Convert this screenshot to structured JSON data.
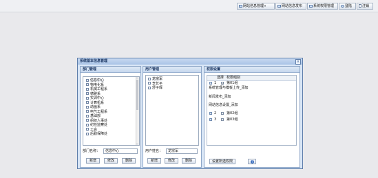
{
  "toolbar": {
    "dropdown_label": "网站信息管理",
    "items": [
      {
        "label": "网站信息发布"
      },
      {
        "label": "系统权限管理"
      },
      {
        "label": "登陆"
      },
      {
        "label": "注销"
      }
    ]
  },
  "window": {
    "title": "系统基本信息管理",
    "close_glyph": "×"
  },
  "dept_panel": {
    "header": "部门管理",
    "items": [
      "信息中心",
      "物电化系",
      "机械工程系",
      "德雅系",
      "实训中心",
      "计算机系",
      "动画系",
      "电气工程系",
      "基础部",
      "组织人事处",
      "纪检监察处",
      "工会",
      "后勤保障处"
    ],
    "name_label": "部门名称：",
    "name_value": "信息中心",
    "buttons": {
      "add": "新增",
      "edit": "修改",
      "delete": "删除"
    }
  },
  "user_panel": {
    "header": "用户管理",
    "items": [
      "龙宗军",
      "李长平",
      "舒子辉"
    ],
    "name_label": "用户姓名：",
    "name_value": "龙宗军",
    "buttons": {
      "add": "新增",
      "edit": "修改",
      "delete": "删除"
    }
  },
  "perm_panel": {
    "header": "权限设置",
    "col_select": "选择",
    "col_group": "权限组别",
    "rows": [
      {
        "num": "1",
        "checked": true,
        "name": "第01组",
        "details": [
          "系统管理与模板上传_添加",
          "新闻发布_添加",
          "网站信息设置_添加"
        ]
      },
      {
        "num": "2",
        "checked": false,
        "name": "第02组"
      },
      {
        "num": "3",
        "checked": false,
        "name": "第03组"
      }
    ],
    "save_button": "设置所选权限",
    "help_glyph": "?"
  },
  "colors": {
    "window_border": "#5f7fab",
    "header_gradient_top": "#dfe9f6",
    "panel_background": "#d9e6f6"
  },
  "icons": [
    "dropdown-icon",
    "file-icon",
    "user-icon",
    "close-icon",
    "help-icon",
    "expand-icon",
    "checkbox-icon"
  ]
}
